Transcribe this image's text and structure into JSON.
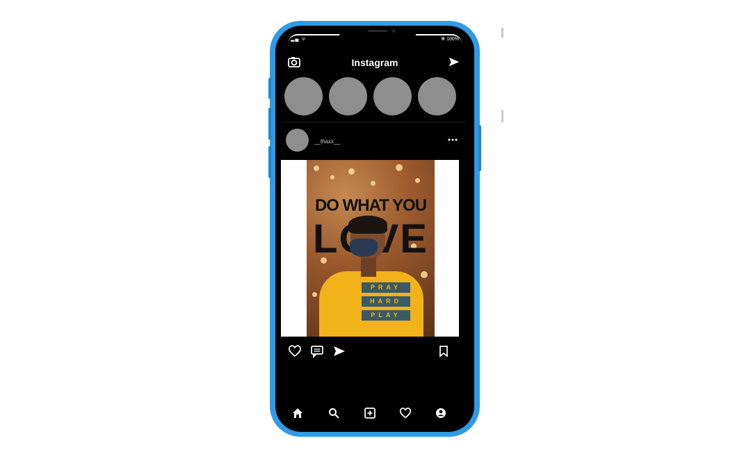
{
  "status": {
    "left_text": "▂▄ ᯤ",
    "battery_text": "✻ 100%"
  },
  "header": {
    "app_title": "Instagram",
    "left_icon": "camera-icon",
    "right_icon": "send-icon"
  },
  "stories": [
    {
      "name": ""
    },
    {
      "name": ""
    },
    {
      "name": ""
    },
    {
      "name": ""
    }
  ],
  "post": {
    "username": "__thaxx__",
    "more_icon": "more-icon",
    "image": {
      "caption_line1": "DO WHAT YOU",
      "caption_line2": "LOVE",
      "shirt_lines": [
        "PRAY",
        "HARD",
        "PLAY"
      ]
    },
    "actions": [
      "heart-icon",
      "comment-icon",
      "share-icon",
      "bookmark-icon"
    ]
  },
  "bottom_nav": [
    "home-icon",
    "search-icon",
    "add-post-icon",
    "activity-heart-icon",
    "profile-icon"
  ],
  "colors": {
    "phone_frame": "#2e9be6",
    "screen_bg": "#000000",
    "story_placeholder": "#8e8e8e",
    "shirt": "#f1b21a"
  }
}
